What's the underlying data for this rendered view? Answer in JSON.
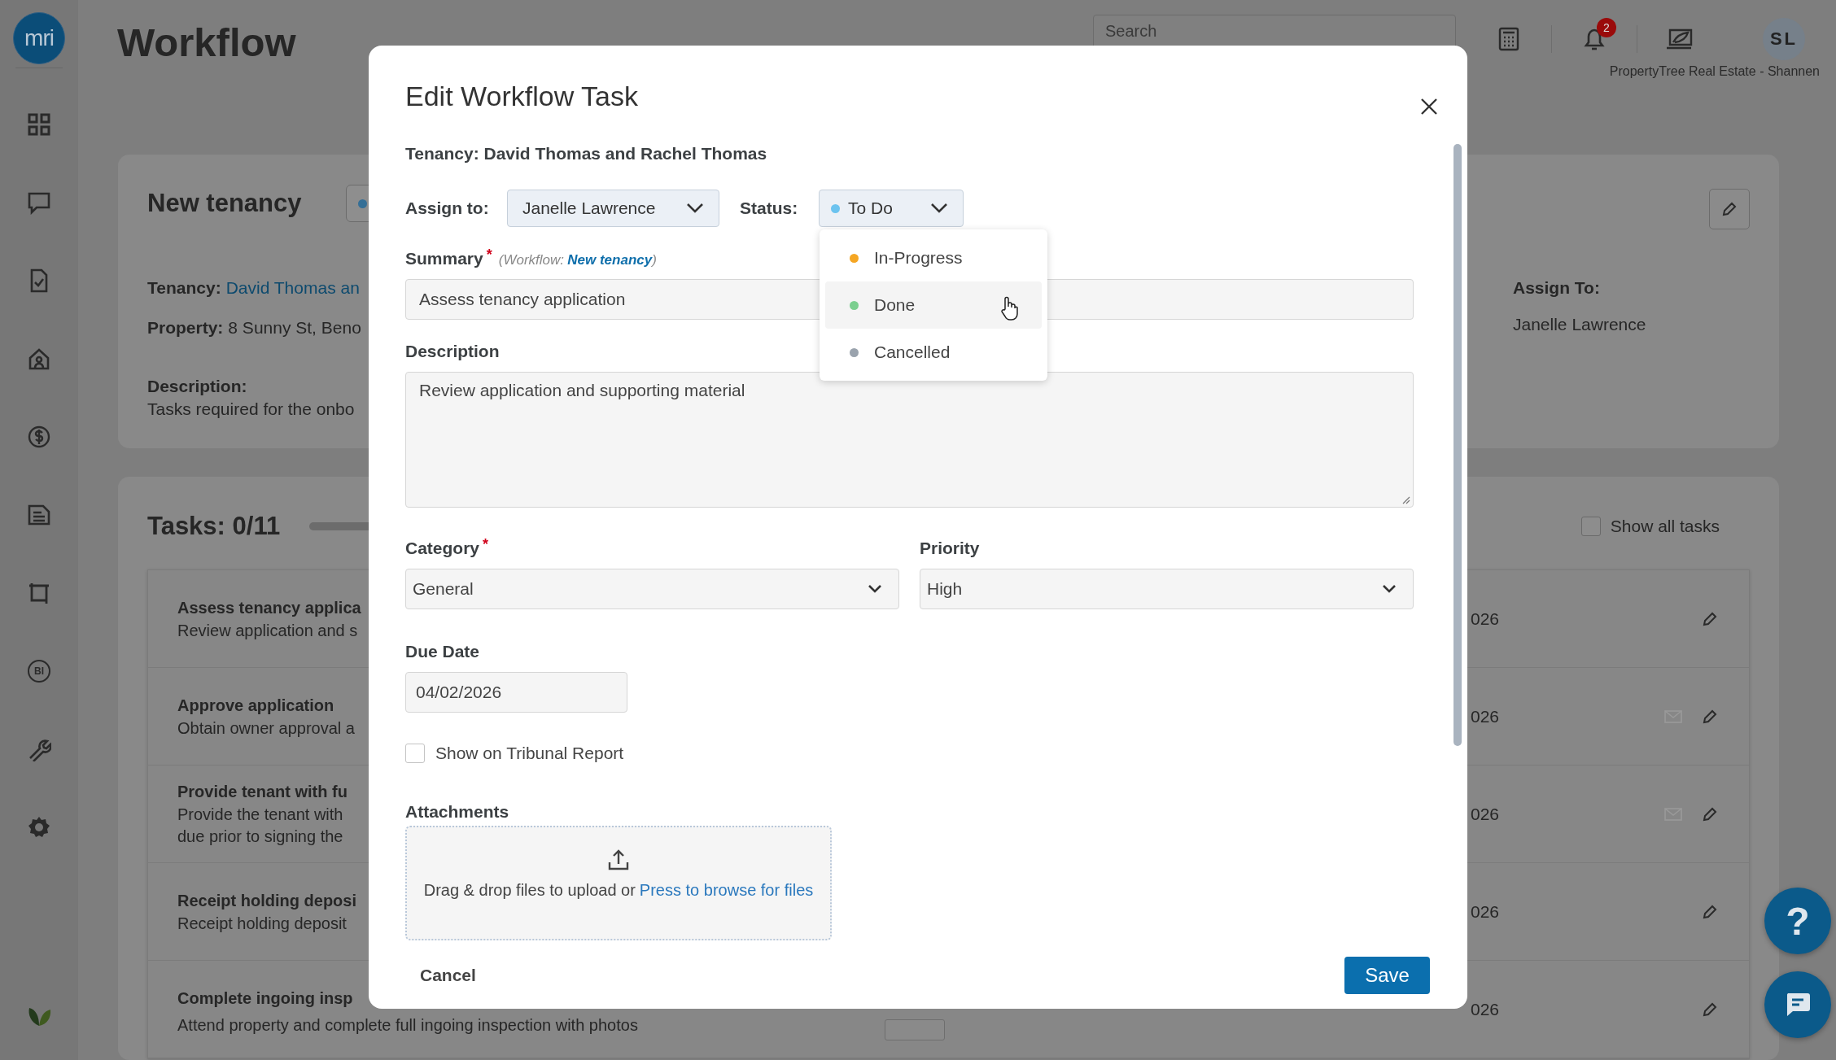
{
  "sidebar": {
    "logo": "mri",
    "items": [
      {
        "kind": "grid"
      },
      {
        "kind": "chat"
      },
      {
        "kind": "document"
      },
      {
        "kind": "home"
      },
      {
        "kind": "dollar"
      },
      {
        "kind": "notes"
      },
      {
        "kind": "frame"
      },
      {
        "kind": "bi",
        "label": "BI"
      },
      {
        "kind": "wrench"
      },
      {
        "kind": "gear"
      }
    ]
  },
  "header": {
    "title": "Workflow",
    "search": {
      "placeholder": "Search"
    },
    "notifications": {
      "count": "2"
    },
    "account": {
      "initials": "SL",
      "caption": "PropertyTree Real Estate - Shannen"
    }
  },
  "workflow_card": {
    "title": "New tenancy",
    "fields": [
      {
        "label": "Tenancy:",
        "value": "David Thomas an",
        "kind": "link"
      },
      {
        "label": "Property:",
        "value": "8 Sunny St, Beno",
        "kind": "text"
      }
    ],
    "description": {
      "label": "Description:",
      "text": "Tasks required for the onbo"
    },
    "assign": {
      "label": "Assign To:",
      "value": "Janelle Lawrence"
    }
  },
  "tasks_card": {
    "title": "Tasks: 0/11",
    "progress": {
      "level": 0
    },
    "show_all": {
      "label": "Show all tasks",
      "checked": false
    },
    "rows": [
      {
        "title": "Assess tenancy applica",
        "description": [
          "Review application and s"
        ],
        "date": "026",
        "mail": false,
        "tag": false
      },
      {
        "title": "Approve application",
        "description": [
          "Obtain owner approval a"
        ],
        "date": "026",
        "mail": true,
        "tag": false
      },
      {
        "title": "Provide tenant with fu",
        "description": [
          "Provide the tenant with",
          "due prior to signing the"
        ],
        "date": "026",
        "mail": true,
        "tag": false
      },
      {
        "title": "Receipt holding deposi",
        "description": [
          "Receipt holding deposit"
        ],
        "date": "026",
        "mail": false,
        "tag": false
      },
      {
        "title": "Complete ingoing insp",
        "description": [
          "Attend property and complete full ingoing inspection with photos"
        ],
        "date": "026",
        "mail": false,
        "tag": true
      }
    ]
  },
  "modal": {
    "title": "Edit Workflow Task",
    "tenancy": "Tenancy: David Thomas and Rachel Thomas",
    "assign": {
      "label": "Assign to:",
      "value": "Janelle Lawrence"
    },
    "status": {
      "label": "Status:",
      "value": "To Do",
      "color": "#6cc3ef",
      "open": true,
      "options": [
        {
          "label": "In-Progress",
          "color": "#f5a623",
          "hovered": false
        },
        {
          "label": "Done",
          "color": "#7bcf8f",
          "hovered": true
        },
        {
          "label": "Cancelled",
          "color": "#9aa3ad",
          "hovered": false
        }
      ]
    },
    "summary": {
      "label": "Summary",
      "required_mark": "*",
      "note": {
        "prefix": "(Workflow:",
        "link": "New tenancy",
        "suffix": ")"
      },
      "value": "Assess tenancy application"
    },
    "description": {
      "label": "Description",
      "value": "Review application and supporting material"
    },
    "category": {
      "label": "Category",
      "required_mark": "*",
      "value": "General"
    },
    "priority": {
      "label": "Priority",
      "value": "High"
    },
    "due_date": {
      "label": "Due Date",
      "value": "04/02/2026"
    },
    "tribunal": {
      "label": "Show on Tribunal Report",
      "checked": false
    },
    "attachments": {
      "label": "Attachments",
      "text": "Drag & drop files to upload or",
      "link": "Press to browse for files"
    },
    "cancel": "Cancel",
    "save": "Save"
  },
  "help": {
    "label": "?"
  }
}
